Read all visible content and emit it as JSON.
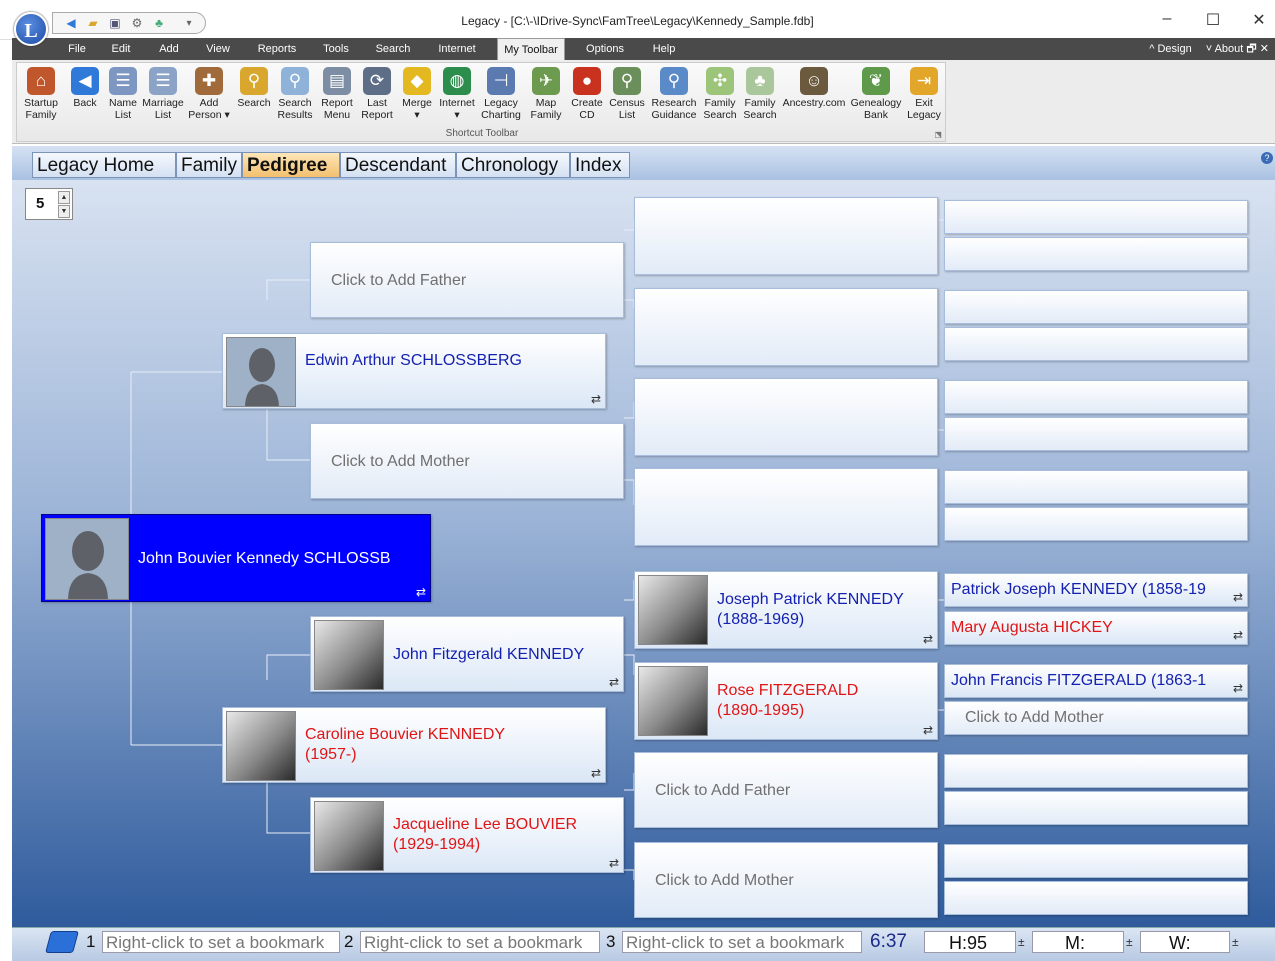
{
  "window": {
    "title": "Legacy - [C:\\-\\IDrive-Sync\\FamTree\\Legacy\\Kennedy_Sample.fdb]",
    "logo_letter": "L",
    "controls": {
      "minimize": "–",
      "maximize": "☐",
      "close": "✕"
    }
  },
  "quick_access": {
    "icons": [
      "back-arrow",
      "folder",
      "save",
      "settings",
      "tree"
    ],
    "dropdown": "▾"
  },
  "menu": {
    "items": [
      "File",
      "Edit",
      "Add",
      "View",
      "Reports",
      "Tools",
      "Search",
      "Internet",
      "My Toolbar",
      "Options",
      "Help"
    ],
    "active": "My Toolbar",
    "right": {
      "design": "^ Design",
      "about": "˅ About 🗗 ✕"
    }
  },
  "ribbon": {
    "group_label": "Shortcut Toolbar",
    "buttons": [
      {
        "line1": "Startup",
        "line2": "Family",
        "icon": "house-icon",
        "color": "#c0562b",
        "glyph": "⌂"
      },
      {
        "line1": "Back",
        "line2": "",
        "icon": "back-arrow-icon",
        "color": "#2f7ad9",
        "glyph": "◀"
      },
      {
        "line1": "Name",
        "line2": "List",
        "icon": "name-list-icon",
        "color": "#7d97c2",
        "glyph": "☰"
      },
      {
        "line1": "Marriage",
        "line2": "List",
        "icon": "marriage-list-icon",
        "color": "#8ca3c8",
        "glyph": "☰"
      },
      {
        "line1": "Add",
        "line2": "Person ▾",
        "icon": "add-person-icon",
        "color": "#a06a3a",
        "glyph": "✚"
      },
      {
        "line1": "Search",
        "line2": "",
        "icon": "search-icon",
        "color": "#d9a72d",
        "glyph": "⚲"
      },
      {
        "line1": "Search",
        "line2": "Results",
        "icon": "search-results-icon",
        "color": "#8fb2d8",
        "glyph": "⚲"
      },
      {
        "line1": "Report",
        "line2": "Menu",
        "icon": "report-menu-icon",
        "color": "#7d8da3",
        "glyph": "▤"
      },
      {
        "line1": "Last",
        "line2": "Report",
        "icon": "last-report-icon",
        "color": "#5d6e86",
        "glyph": "⟳"
      },
      {
        "line1": "Merge",
        "line2": "▾",
        "icon": "merge-icon",
        "color": "#e3b820",
        "glyph": "◆"
      },
      {
        "line1": "Internet",
        "line2": "▾",
        "icon": "globe-icon",
        "color": "#2c8d4c",
        "glyph": "◍"
      },
      {
        "line1": "Legacy",
        "line2": "Charting",
        "icon": "charting-icon",
        "color": "#5a7ab0",
        "glyph": "⊣"
      },
      {
        "line1": "Map",
        "line2": "Family",
        "icon": "map-family-icon",
        "color": "#6c9a4e",
        "glyph": "✈"
      },
      {
        "line1": "Create",
        "line2": "CD",
        "icon": "create-cd-icon",
        "color": "#c8321f",
        "glyph": "●"
      },
      {
        "line1": "Census",
        "line2": "List",
        "icon": "census-list-icon",
        "color": "#6b8f5a",
        "glyph": "⚲"
      },
      {
        "line1": "Research",
        "line2": "Guidance",
        "icon": "research-guidance-icon",
        "color": "#5b8ac8",
        "glyph": "⚲"
      },
      {
        "line1": "Family",
        "line2": "Search",
        "icon": "family-search-icon",
        "color": "#9cc57a",
        "glyph": "✣"
      },
      {
        "line1": "Family",
        "line2": "Search",
        "icon": "family-tree-search-icon",
        "color": "#a9c79a",
        "glyph": "♣"
      },
      {
        "line1": "Ancestry.com",
        "line2": "",
        "icon": "ancestry-icon",
        "color": "#6b5a3e",
        "glyph": "☺"
      },
      {
        "line1": "Genealogy",
        "line2": "Bank",
        "icon": "genealogy-bank-icon",
        "color": "#5f9a4a",
        "glyph": "❦"
      },
      {
        "line1": "Exit",
        "line2": "Legacy",
        "icon": "exit-icon",
        "color": "#e2a62a",
        "glyph": "⇥"
      }
    ]
  },
  "tabs": [
    "Legacy Home",
    "Family",
    "Pedigree",
    "Descendant",
    "Chronology",
    "Index"
  ],
  "active_tab": "Pedigree",
  "generations": "5",
  "add_father": "Click to Add Father",
  "add_mother": "Click to Add Mother",
  "people": {
    "root": {
      "name": "John Bouvier Kennedy SCHLOSSB"
    },
    "father": {
      "name": "Edwin Arthur SCHLOSSBERG"
    },
    "mother": {
      "name": "Caroline Bouvier KENNEDY",
      "dates": "(1957-)"
    },
    "mgf": {
      "name": "John Fitzgerald KENNEDY"
    },
    "mgm": {
      "name": "Jacqueline Lee BOUVIER",
      "dates": "(1929-1994)"
    },
    "mgf_father": {
      "name": "Joseph Patrick KENNEDY",
      "dates": "(1888-1969)"
    },
    "mgf_mother": {
      "name": "Rose FITZGERALD",
      "dates": "(1890-1995)"
    },
    "gen5_a": "Patrick Joseph KENNEDY (1858-19",
    "gen5_b": "Mary Augusta HICKEY",
    "gen5_c": "John Francis FITZGERALD (1863-1"
  },
  "status": {
    "bookmarks": [
      {
        "num": "1",
        "text": "Right-click to set a bookmark"
      },
      {
        "num": "2",
        "text": "Right-click to set a bookmark"
      },
      {
        "num": "3",
        "text": "Right-click to set a bookmark"
      }
    ],
    "time": "6:37",
    "h": "H:95",
    "m": "M:",
    "w": "W:",
    "pm": "±"
  },
  "colors": {
    "male": "#1420b0",
    "female": "#e01515",
    "selected": "#0000ff"
  }
}
